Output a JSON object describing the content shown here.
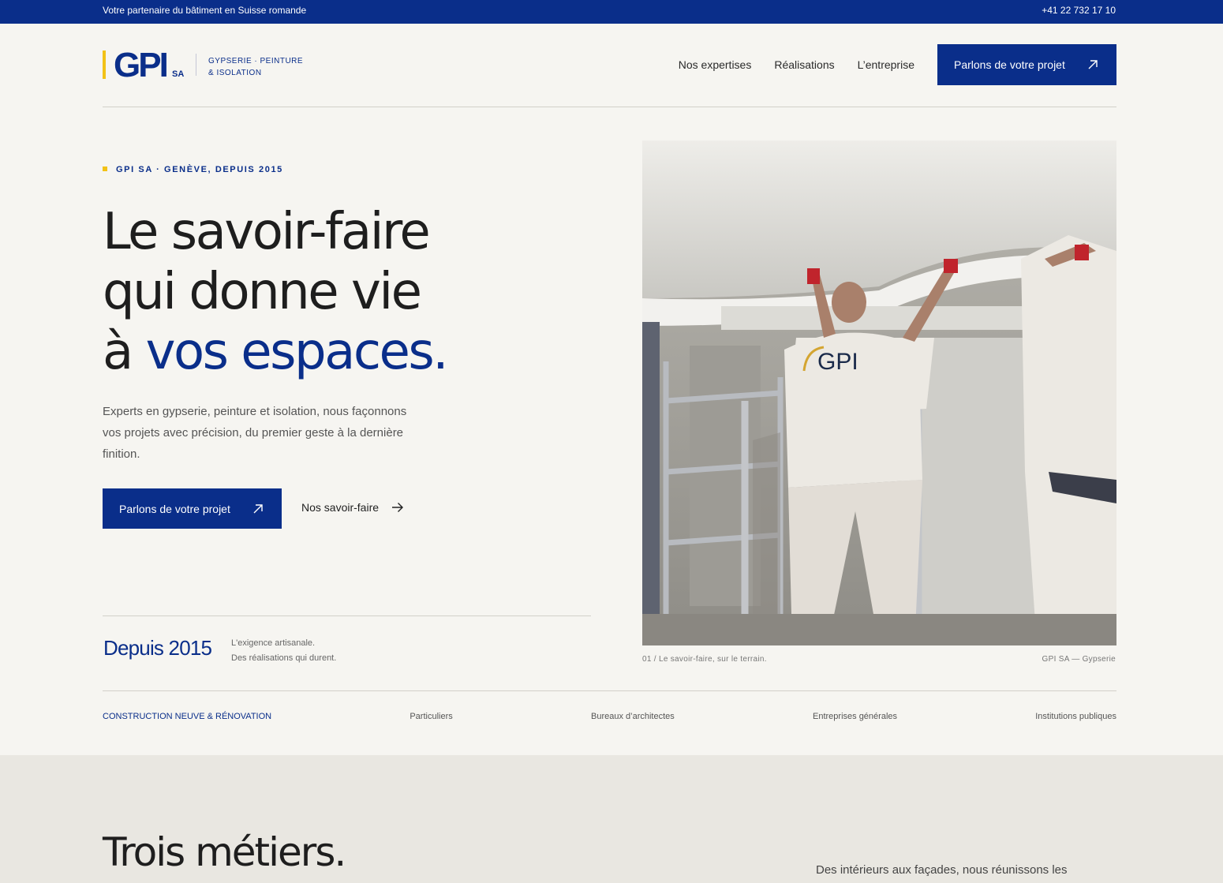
{
  "topbar": {
    "tagline": "Votre partenaire du bâtiment en Suisse romande",
    "phone": "+41 22 732 17 10"
  },
  "brand": {
    "name": "GPI",
    "suffix": "SA",
    "sub_line1": "GYPSERIE · PEINTURE",
    "sub_line2": "& ISOLATION",
    "primary_color": "#0a2e8a",
    "accent_color": "#f2c217"
  },
  "nav": {
    "items": [
      "Nos expertises",
      "Réalisations",
      "L’entreprise"
    ],
    "cta": "Parlons de votre projet"
  },
  "hero": {
    "eyebrow": "GPI SA · GENÈVE, DEPUIS 2015",
    "title_line1": "Le savoir-faire",
    "title_line2": "qui donne vie",
    "title_line3_prefix": "à ",
    "title_line3_highlight": "vos espaces.",
    "lead": "Experts en gypserie, peinture et isolation, nous façonnons vos projets avec précision, du premier geste à la dernière finition.",
    "cta_primary": "Parlons de votre projet",
    "cta_secondary": "Nos savoir-faire",
    "since": "Depuis 2015",
    "since_note_1": "L'exigence artisanale.",
    "since_note_2": "Des réalisations qui durent.",
    "photo_caption_left": "01 / Le savoir-faire, sur le terrain.",
    "photo_caption_right": "GPI SA — Gypserie",
    "photo_shirt_logo": "GPI"
  },
  "clients": {
    "lead": "CONSTRUCTION NEUVE & RÉNOVATION",
    "items": [
      "Particuliers",
      "Bureaux d’architectes",
      "Entreprises générales",
      "Institutions publiques"
    ]
  },
  "section2": {
    "title_line1": "Trois métiers.",
    "intro": "Des intérieurs aux façades, nous réunissons les"
  }
}
